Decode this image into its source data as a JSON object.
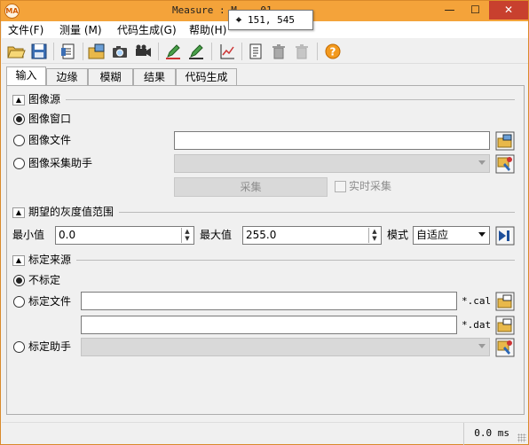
{
  "window": {
    "title": "Measure : M... 01",
    "app_icon_text": "MA",
    "minimize": "—",
    "maximize": "☐",
    "close": "✕"
  },
  "tooltip": {
    "text": "151, 545"
  },
  "menu": [
    "文件(F)",
    "测量 (M)",
    "代码生成(G)",
    "帮助(H)"
  ],
  "toolbar": {
    "icons": [
      "open-folder-icon",
      "save-icon",
      "load-icon",
      "open-image-icon",
      "camera-icon",
      "video-camera-icon",
      "edit-icon",
      "edit-alt-icon",
      "chart-icon",
      "document-icon",
      "trash-icon",
      "trash-disabled-icon",
      "help-icon"
    ]
  },
  "tabs": [
    "输入",
    "边缘",
    "模糊",
    "结果",
    "代码生成"
  ],
  "image_source": {
    "header": "图像源",
    "option_window": "图像窗口",
    "option_file": "图像文件",
    "option_acq": "图像采集助手",
    "file_value": "",
    "acq_value": "",
    "acquire_button": "采集",
    "live_checkbox": "实时采集"
  },
  "gray_range": {
    "header": "期望的灰度值范围",
    "min_label": "最小值",
    "min_value": "0.0",
    "max_label": "最大值",
    "max_value": "255.0",
    "mode_label": "模式",
    "mode_value": "自适应"
  },
  "calibration": {
    "header": "标定来源",
    "option_none": "不标定",
    "option_file": "标定文件",
    "option_helper": "标定助手",
    "cal_suffix": "*.cal",
    "dat_suffix": "*.dat",
    "cal_value": "",
    "dat_value": "",
    "helper_value": ""
  },
  "status": {
    "time": "0.0 ms"
  },
  "colors": {
    "title_bar": "#f4a33a",
    "close_button": "#c8402e"
  }
}
